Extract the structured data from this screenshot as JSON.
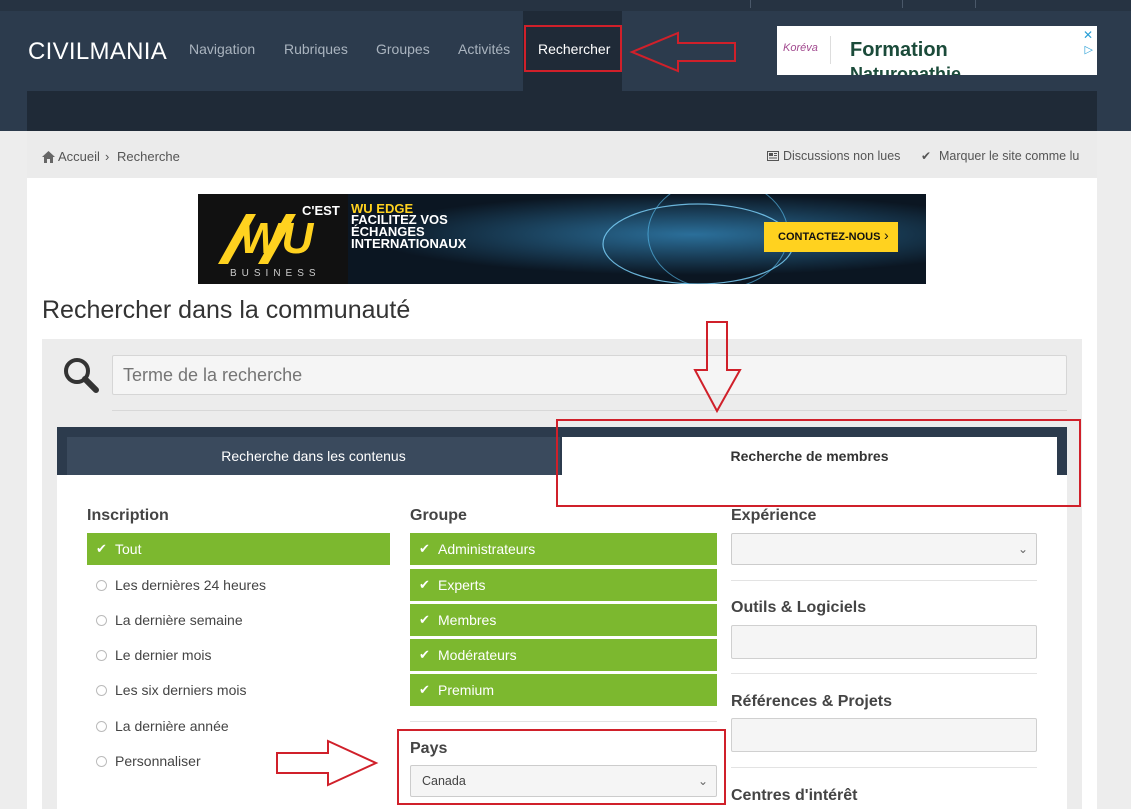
{
  "header": {
    "brand": "CIVILMANIA",
    "nav": [
      "Navigation",
      "Rubriques",
      "Groupes",
      "Activités"
    ],
    "nav_active": "Rechercher"
  },
  "ad_top": {
    "logo_text": "Koréva",
    "line1": "Formation",
    "line2": "Naturopathie"
  },
  "breadcrumb": {
    "home": "Accueil",
    "separator": "›",
    "current": "Recherche",
    "unread": "Discussions non lues",
    "mark_read": "Marquer le site comme lu"
  },
  "banner": {
    "brand_prefix": "C'EST",
    "logo": "WU",
    "business": "BUSINESS",
    "headline1": "WU EDGE",
    "headline2": "FACILITEZ VOS",
    "headline3": "ÉCHANGES",
    "headline4": "INTERNATIONAUX",
    "cta": "CONTACTEZ-NOUS"
  },
  "page": {
    "title": "Rechercher dans la communauté",
    "search_placeholder": "Terme de la recherche"
  },
  "tabs": {
    "content": "Recherche dans les contenus",
    "members": "Recherche de membres"
  },
  "inscription": {
    "title": "Inscription",
    "selected": "Tout",
    "options": [
      "Les dernières 24 heures",
      "La dernière semaine",
      "Le dernier mois",
      "Les six derniers mois",
      "La dernière année",
      "Personnaliser"
    ]
  },
  "groupe": {
    "title": "Groupe",
    "options": [
      "Administrateurs",
      "Experts",
      "Membres",
      "Modérateurs",
      "Premium"
    ]
  },
  "pays": {
    "title": "Pays",
    "value": "Canada"
  },
  "right_fields": {
    "experience": "Expérience",
    "outils": "Outils & Logiciels",
    "references": "Références & Projets",
    "centres": "Centres d'intérêt"
  },
  "icons": {
    "check": "✔",
    "chevron": "⌄",
    "home": "home-icon",
    "search": "search-icon"
  },
  "colors": {
    "header": "#2c3b4d",
    "accent_green": "#7cb82f",
    "annotation_red": "#d0202a"
  }
}
